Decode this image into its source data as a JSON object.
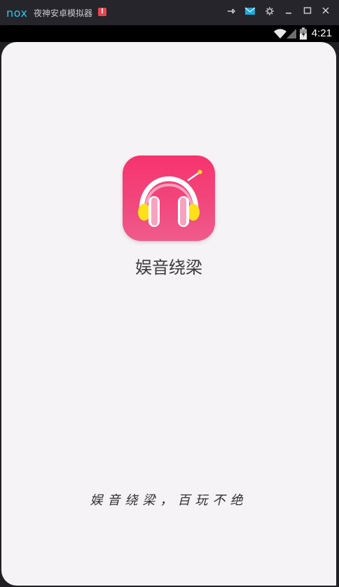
{
  "window": {
    "logo": "nox",
    "title": "夜神安卓模拟器",
    "alert_badge": "!",
    "buttons": {
      "pin": "pin-icon",
      "message": "mail-icon",
      "settings": "gear-icon",
      "minimize": "minimize-icon",
      "maximize": "maximize-icon",
      "close": "close-icon"
    }
  },
  "statusbar": {
    "time": "4:21",
    "icons": [
      "wifi-icon",
      "signal-icon",
      "battery-icon"
    ]
  },
  "splash": {
    "app_name": "娱音绕梁",
    "slogan": "娱音绕梁，百玩不绝",
    "icon": "headphones-icon"
  },
  "colors": {
    "icon_gradient_top": "#f7336f",
    "icon_gradient_bottom": "#ef5b8b",
    "earcup": "#ffe01b",
    "logo": "#2ec5e8",
    "screen_bg": "#f6f3f6"
  }
}
